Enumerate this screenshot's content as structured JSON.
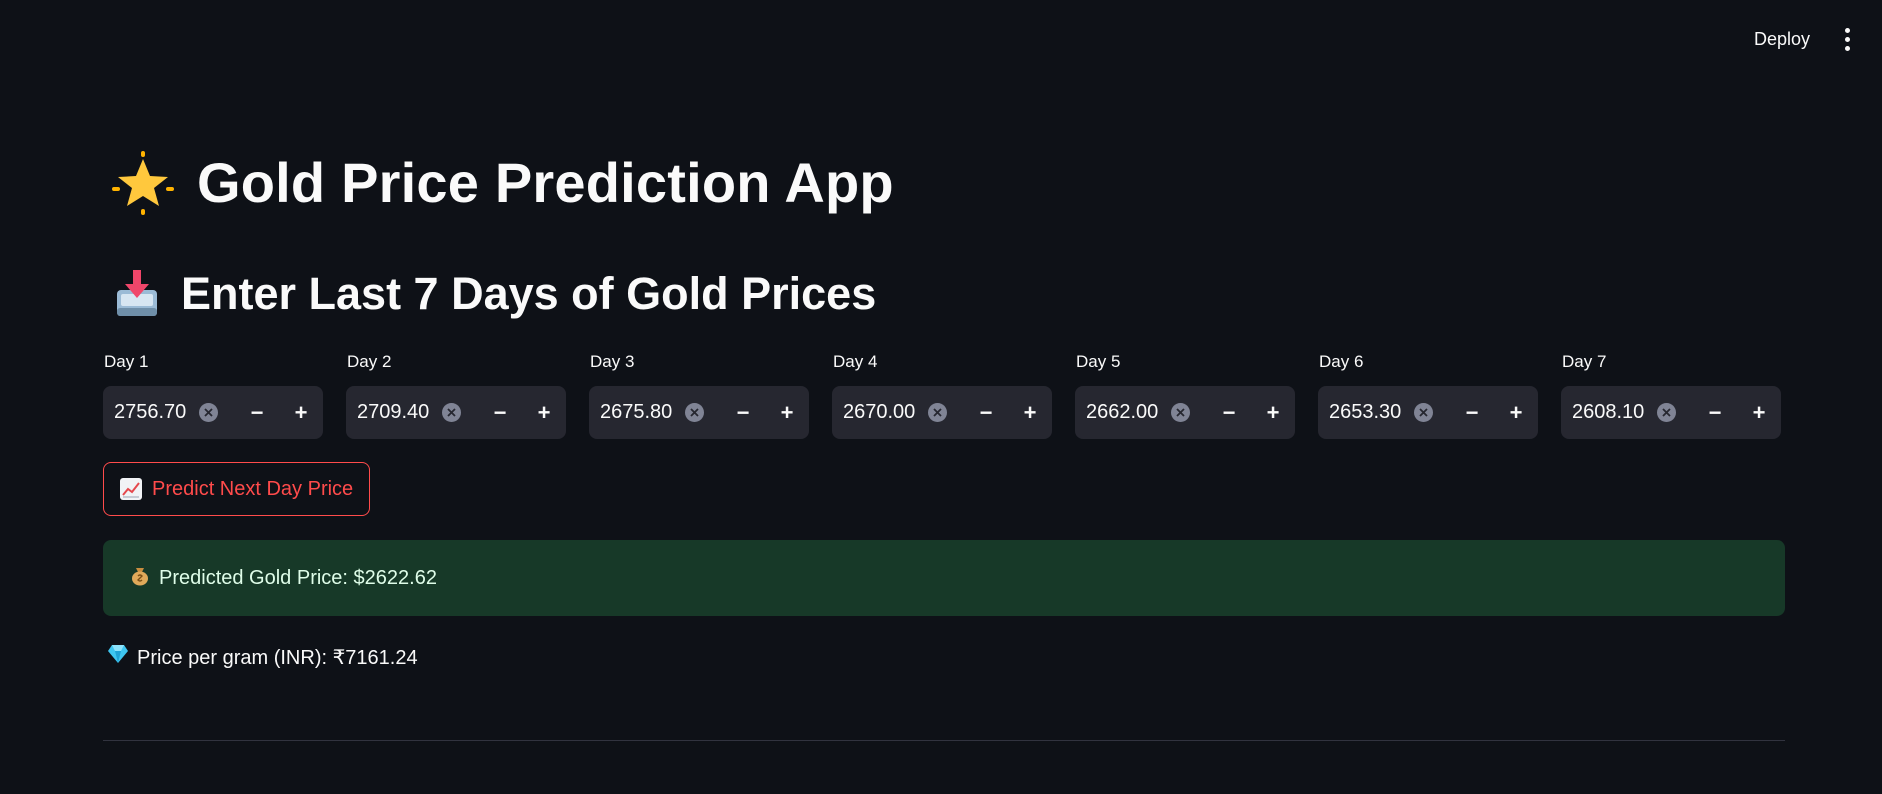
{
  "header": {
    "deploy_label": "Deploy",
    "menu_icon": "vertical-dots-icon"
  },
  "page": {
    "title": "Gold Price Prediction App",
    "title_icon": "glowing-star-icon",
    "subtitle": "Enter Last 7 Days of Gold Prices",
    "subtitle_icon": "inbox-tray-icon"
  },
  "inputs": [
    {
      "label": "Day 1",
      "value": "2756.70"
    },
    {
      "label": "Day 2",
      "value": "2709.40"
    },
    {
      "label": "Day 3",
      "value": "2675.80"
    },
    {
      "label": "Day 4",
      "value": "2670.00"
    },
    {
      "label": "Day 5",
      "value": "2662.00"
    },
    {
      "label": "Day 6",
      "value": "2653.30"
    },
    {
      "label": "Day 7",
      "value": "2608.10"
    }
  ],
  "stepper": {
    "minus": "−",
    "plus": "+"
  },
  "predict_button": {
    "label": "Predict Next Day Price",
    "icon": "chart-increasing-icon"
  },
  "result": {
    "predicted_text": "Predicted Gold Price: $2622.62",
    "predicted_icon": "money-bag-icon",
    "inr_text": "Price per gram (INR): ₹7161.24",
    "inr_icon": "gem-icon"
  },
  "colors": {
    "background": "#0e1117",
    "input_bg": "#262730",
    "accent_red": "#ff4b4b",
    "success_bg": "#173928"
  }
}
